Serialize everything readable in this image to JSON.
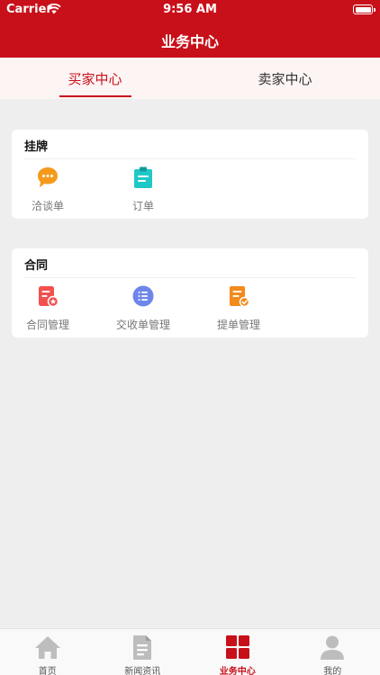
{
  "status_bar": {
    "carrier": "Carrier",
    "time": "9:56 AM"
  },
  "header": {
    "title": "业务中心"
  },
  "tabs": [
    {
      "label": "买家中心",
      "active": true
    },
    {
      "label": "卖家中心",
      "active": false
    }
  ],
  "sections": [
    {
      "title": "挂牌",
      "items": [
        {
          "label": "洽谈单",
          "icon": "chat-bubble-icon"
        },
        {
          "label": "订单",
          "icon": "clipboard-icon"
        }
      ]
    },
    {
      "title": "合同",
      "items": [
        {
          "label": "合同管理",
          "icon": "contract-icon"
        },
        {
          "label": "交收单管理",
          "icon": "list-circle-icon"
        },
        {
          "label": "提单管理",
          "icon": "bill-check-icon"
        }
      ]
    }
  ],
  "tabbar": [
    {
      "label": "首页",
      "icon": "home-icon"
    },
    {
      "label": "新闻资讯",
      "icon": "news-icon"
    },
    {
      "label": "业务中心",
      "icon": "grid-icon",
      "active": true
    },
    {
      "label": "我的",
      "icon": "user-icon"
    }
  ],
  "colors": {
    "brand": "#c8101a",
    "tab_bg": "#fdf4f4",
    "page_bg": "#eeeeee"
  }
}
